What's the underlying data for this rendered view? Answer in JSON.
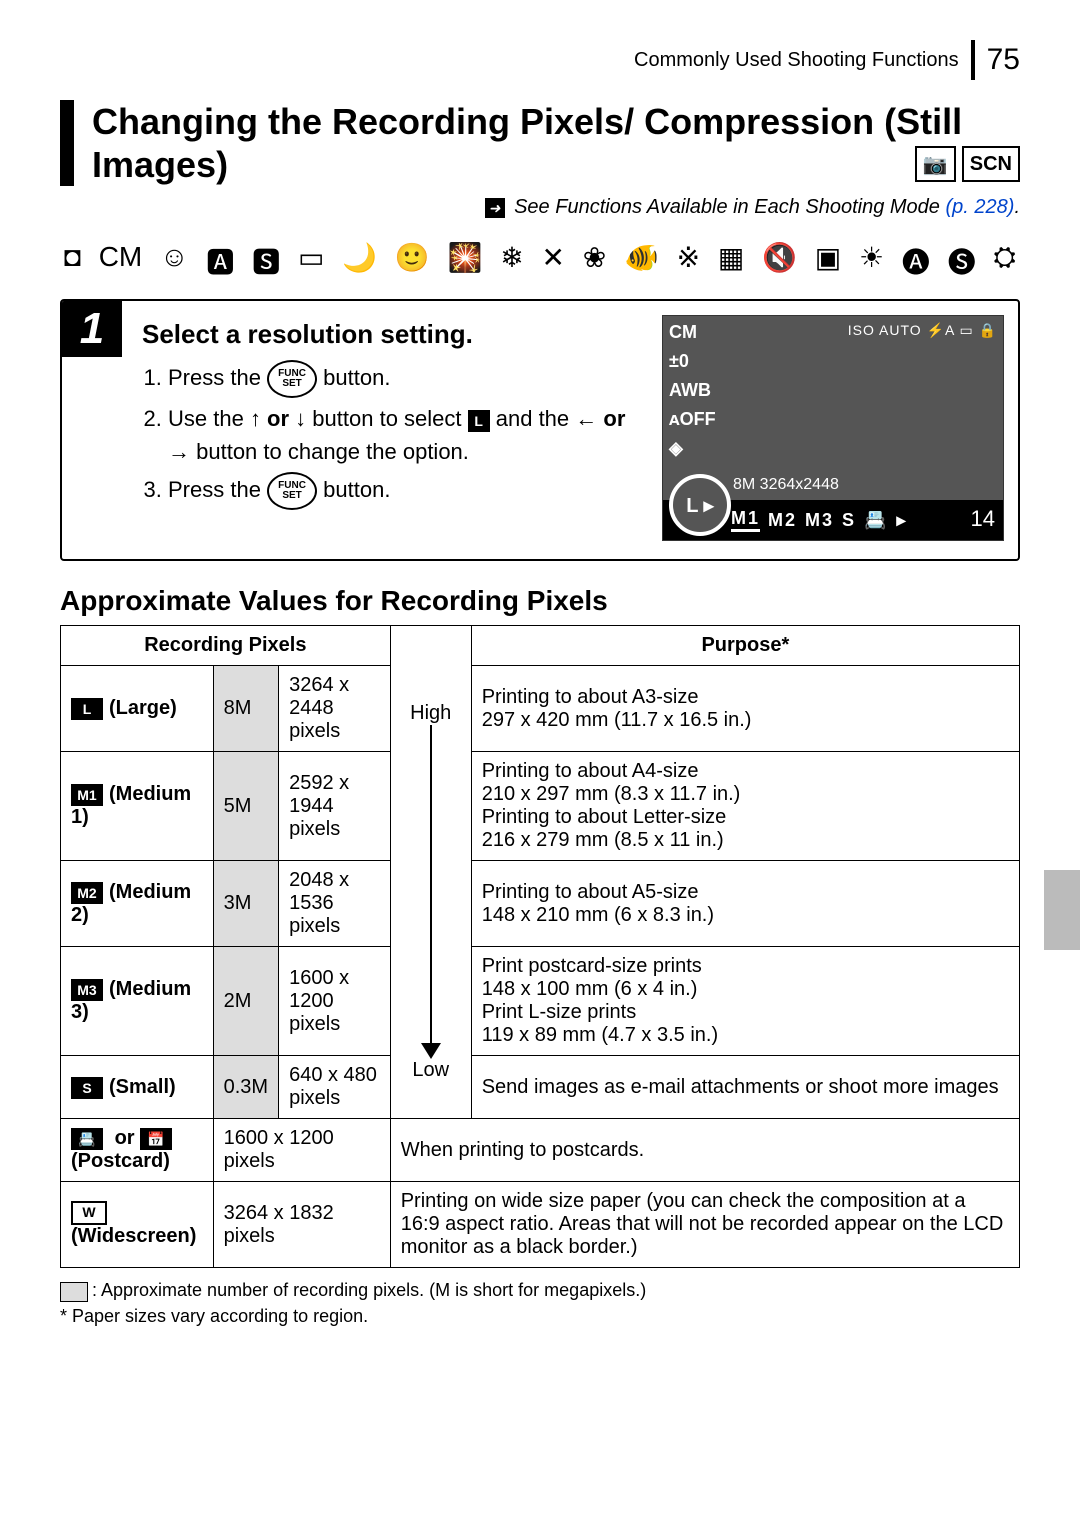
{
  "header": {
    "section": "Commonly Used Shooting Functions",
    "page_number": "75"
  },
  "title": "Changing the Recording Pixels/ Compression (Still Images)",
  "mode_badges": [
    "📷",
    "SCN"
  ],
  "see_also": {
    "prefix": "See Functions Available in Each Shooting Mode",
    "link_label": "(p. 228)",
    "suffix": "."
  },
  "mode_strip_alt": "Row of available shooting-mode icons",
  "step": {
    "number": "1",
    "title": "Select a resolution setting.",
    "items": [
      {
        "pre": "Press the ",
        "btn": "FUNC SET",
        "post": " button."
      },
      {
        "pre": "Use the ",
        "arrows1": "↑ or ↓",
        "mid": " button to select ",
        "icon": "L",
        "post2_pre": " and the ",
        "arrows2": "← or →",
        "post2_post": " button to change the option."
      },
      {
        "pre": "Press the ",
        "btn": "FUNC SET",
        "post": " button."
      }
    ]
  },
  "lcd": {
    "left_icons": [
      "CM",
      "±0",
      "AWB",
      "ᴀOFF",
      "◈"
    ],
    "top_right": "ISO AUTO  ⚡A  ▭  🔒",
    "info_line": "8M 3264x2448",
    "selected": "L ▸",
    "options": [
      "M1",
      "M2",
      "M3",
      "S",
      "📇",
      "▸"
    ],
    "shots_left": "14"
  },
  "table_title": "Approximate Values for Recording Pixels",
  "table": {
    "head": {
      "c1": "Recording Pixels",
      "c2": "Purpose*"
    },
    "range_top": "High",
    "range_bottom": "Low",
    "rows": [
      {
        "icon": "L",
        "label": "(Large)",
        "mp": "8M",
        "res": "3264 x 2448 pixels",
        "purpose": "Printing to about A3-size\n297 x 420 mm (11.7 x 16.5 in.)"
      },
      {
        "icon": "M1",
        "label": "(Medium 1)",
        "mp": "5M",
        "res": "2592 x 1944 pixels",
        "purpose": "Printing to about A4-size\n210 x 297 mm (8.3 x 11.7 in.)\nPrinting to about Letter-size\n216 x 279 mm (8.5 x 11 in.)"
      },
      {
        "icon": "M2",
        "label": "(Medium 2)",
        "mp": "3M",
        "res": "2048 x 1536 pixels",
        "purpose": "Printing to about A5-size\n148 x 210 mm (6 x 8.3 in.)"
      },
      {
        "icon": "M3",
        "label": "(Medium 3)",
        "mp": "2M",
        "res": "1600 x 1200 pixels",
        "purpose": "Print postcard-size prints\n148 x 100 mm (6 x 4 in.)\nPrint L-size prints\n119 x 89 mm (4.7 x 3.5 in.)"
      },
      {
        "icon": "S",
        "label": "(Small)",
        "mp": "0.3M",
        "res": "640 x 480 pixels",
        "purpose": "Send images as e-mail attachments or shoot more images"
      }
    ],
    "postcard": {
      "label_prefix": "or",
      "label_paren": "(Postcard)",
      "res": "1600 x 1200 pixels",
      "purpose": "When printing to postcards."
    },
    "widescreen": {
      "icon": "W",
      "label_paren": "(Widescreen)",
      "res": "3264 x 1832 pixels",
      "purpose": "Printing on wide size paper (you can check the composition at a 16:9 aspect ratio. Areas that will not be recorded appear on the LCD monitor as a black border.)"
    }
  },
  "footnotes": {
    "f1": ": Approximate number of recording pixels. (M is short for megapixels.)",
    "f2": "* Paper sizes vary according to region."
  }
}
